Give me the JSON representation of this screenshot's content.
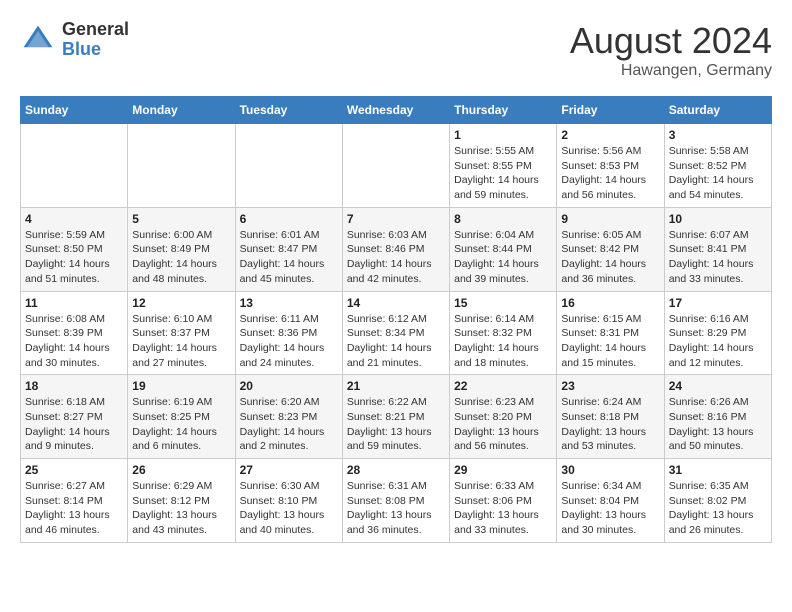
{
  "header": {
    "logo_general": "General",
    "logo_blue": "Blue",
    "month_title": "August 2024",
    "location": "Hawangen, Germany"
  },
  "days_of_week": [
    "Sunday",
    "Monday",
    "Tuesday",
    "Wednesday",
    "Thursday",
    "Friday",
    "Saturday"
  ],
  "weeks": [
    [
      {
        "day": "",
        "info": ""
      },
      {
        "day": "",
        "info": ""
      },
      {
        "day": "",
        "info": ""
      },
      {
        "day": "",
        "info": ""
      },
      {
        "day": "1",
        "info": "Sunrise: 5:55 AM\nSunset: 8:55 PM\nDaylight: 14 hours\nand 59 minutes."
      },
      {
        "day": "2",
        "info": "Sunrise: 5:56 AM\nSunset: 8:53 PM\nDaylight: 14 hours\nand 56 minutes."
      },
      {
        "day": "3",
        "info": "Sunrise: 5:58 AM\nSunset: 8:52 PM\nDaylight: 14 hours\nand 54 minutes."
      }
    ],
    [
      {
        "day": "4",
        "info": "Sunrise: 5:59 AM\nSunset: 8:50 PM\nDaylight: 14 hours\nand 51 minutes."
      },
      {
        "day": "5",
        "info": "Sunrise: 6:00 AM\nSunset: 8:49 PM\nDaylight: 14 hours\nand 48 minutes."
      },
      {
        "day": "6",
        "info": "Sunrise: 6:01 AM\nSunset: 8:47 PM\nDaylight: 14 hours\nand 45 minutes."
      },
      {
        "day": "7",
        "info": "Sunrise: 6:03 AM\nSunset: 8:46 PM\nDaylight: 14 hours\nand 42 minutes."
      },
      {
        "day": "8",
        "info": "Sunrise: 6:04 AM\nSunset: 8:44 PM\nDaylight: 14 hours\nand 39 minutes."
      },
      {
        "day": "9",
        "info": "Sunrise: 6:05 AM\nSunset: 8:42 PM\nDaylight: 14 hours\nand 36 minutes."
      },
      {
        "day": "10",
        "info": "Sunrise: 6:07 AM\nSunset: 8:41 PM\nDaylight: 14 hours\nand 33 minutes."
      }
    ],
    [
      {
        "day": "11",
        "info": "Sunrise: 6:08 AM\nSunset: 8:39 PM\nDaylight: 14 hours\nand 30 minutes."
      },
      {
        "day": "12",
        "info": "Sunrise: 6:10 AM\nSunset: 8:37 PM\nDaylight: 14 hours\nand 27 minutes."
      },
      {
        "day": "13",
        "info": "Sunrise: 6:11 AM\nSunset: 8:36 PM\nDaylight: 14 hours\nand 24 minutes."
      },
      {
        "day": "14",
        "info": "Sunrise: 6:12 AM\nSunset: 8:34 PM\nDaylight: 14 hours\nand 21 minutes."
      },
      {
        "day": "15",
        "info": "Sunrise: 6:14 AM\nSunset: 8:32 PM\nDaylight: 14 hours\nand 18 minutes."
      },
      {
        "day": "16",
        "info": "Sunrise: 6:15 AM\nSunset: 8:31 PM\nDaylight: 14 hours\nand 15 minutes."
      },
      {
        "day": "17",
        "info": "Sunrise: 6:16 AM\nSunset: 8:29 PM\nDaylight: 14 hours\nand 12 minutes."
      }
    ],
    [
      {
        "day": "18",
        "info": "Sunrise: 6:18 AM\nSunset: 8:27 PM\nDaylight: 14 hours\nand 9 minutes."
      },
      {
        "day": "19",
        "info": "Sunrise: 6:19 AM\nSunset: 8:25 PM\nDaylight: 14 hours\nand 6 minutes."
      },
      {
        "day": "20",
        "info": "Sunrise: 6:20 AM\nSunset: 8:23 PM\nDaylight: 14 hours\nand 2 minutes."
      },
      {
        "day": "21",
        "info": "Sunrise: 6:22 AM\nSunset: 8:21 PM\nDaylight: 13 hours\nand 59 minutes."
      },
      {
        "day": "22",
        "info": "Sunrise: 6:23 AM\nSunset: 8:20 PM\nDaylight: 13 hours\nand 56 minutes."
      },
      {
        "day": "23",
        "info": "Sunrise: 6:24 AM\nSunset: 8:18 PM\nDaylight: 13 hours\nand 53 minutes."
      },
      {
        "day": "24",
        "info": "Sunrise: 6:26 AM\nSunset: 8:16 PM\nDaylight: 13 hours\nand 50 minutes."
      }
    ],
    [
      {
        "day": "25",
        "info": "Sunrise: 6:27 AM\nSunset: 8:14 PM\nDaylight: 13 hours\nand 46 minutes."
      },
      {
        "day": "26",
        "info": "Sunrise: 6:29 AM\nSunset: 8:12 PM\nDaylight: 13 hours\nand 43 minutes."
      },
      {
        "day": "27",
        "info": "Sunrise: 6:30 AM\nSunset: 8:10 PM\nDaylight: 13 hours\nand 40 minutes."
      },
      {
        "day": "28",
        "info": "Sunrise: 6:31 AM\nSunset: 8:08 PM\nDaylight: 13 hours\nand 36 minutes."
      },
      {
        "day": "29",
        "info": "Sunrise: 6:33 AM\nSunset: 8:06 PM\nDaylight: 13 hours\nand 33 minutes."
      },
      {
        "day": "30",
        "info": "Sunrise: 6:34 AM\nSunset: 8:04 PM\nDaylight: 13 hours\nand 30 minutes."
      },
      {
        "day": "31",
        "info": "Sunrise: 6:35 AM\nSunset: 8:02 PM\nDaylight: 13 hours\nand 26 minutes."
      }
    ]
  ]
}
